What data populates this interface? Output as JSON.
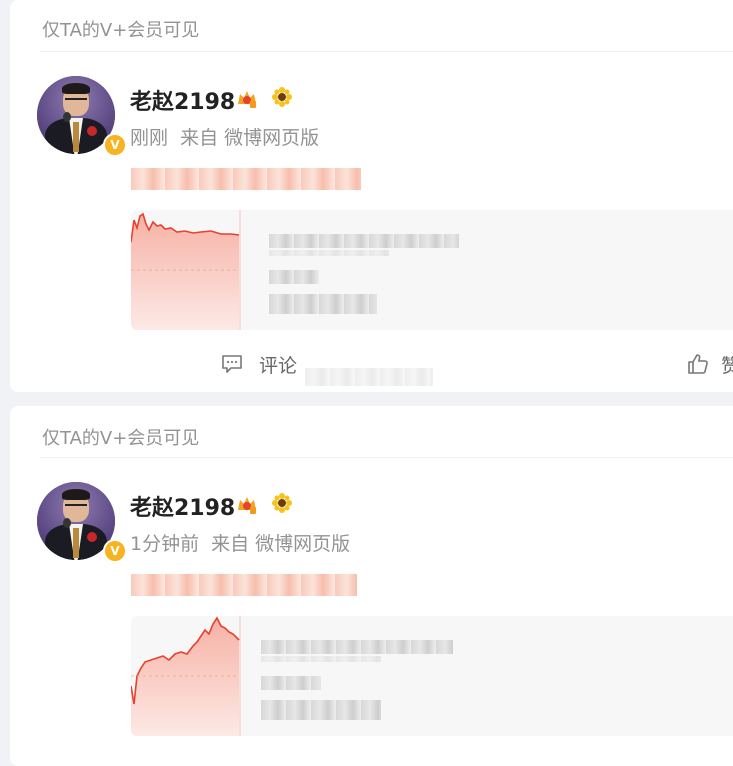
{
  "posts": [
    {
      "visibility": "仅TA的V+会员可见",
      "author": "老赵2198",
      "time": "刚刚",
      "source": "来自 微博网页版",
      "verified": "V",
      "comment_label": "评论",
      "like_label": "赞"
    },
    {
      "visibility": "仅TA的V+会员可见",
      "author": "老赵2198",
      "time": "1分钟前",
      "source": "来自 微博网页版",
      "verified": "V"
    }
  ],
  "colors": {
    "accent_verified": "#f8b320",
    "chart_line": "#e8412e",
    "chart_fill": "#fbd3cd"
  },
  "icons": [
    "crown-icon",
    "sunflower-icon",
    "comment-icon",
    "like-icon"
  ]
}
